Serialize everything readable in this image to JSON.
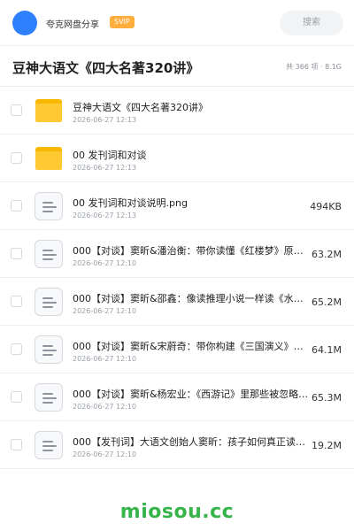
{
  "header": {
    "user_name": "夸克网盘分享",
    "badge": "SVIP",
    "search_placeholder": "搜索"
  },
  "folder": {
    "title": "豆神大语文《四大名著320讲》",
    "meta": "共 366 项 · 8.1G"
  },
  "files": [
    {
      "type": "folder",
      "name": "豆神大语文《四大名著320讲》",
      "date": "2026-06-27 12:13",
      "size": ""
    },
    {
      "type": "folder",
      "name": "00 发刊词和对谈",
      "date": "2026-06-27 12:13",
      "size": ""
    },
    {
      "type": "file",
      "name": "00 发刊词和对谈说明.png",
      "date": "2026-06-27 12:13",
      "size": "494KB"
    },
    {
      "type": "file",
      "name": "000【对谈】窦昕&潘治衡：带你读懂《红楼梦》原著…",
      "date": "2026-06-27 12:10",
      "size": "63.2M"
    },
    {
      "type": "file",
      "name": "000【对谈】窦昕&邵鑫：像读推理小说一样读《水浒…",
      "date": "2026-06-27 12:10",
      "size": "65.2M"
    },
    {
      "type": "file",
      "name": "000【对谈】窦昕&宋蔚奇：带你构建《三国演义》的…",
      "date": "2026-06-27 12:10",
      "size": "64.1M"
    },
    {
      "type": "file",
      "name": "000【对谈】窦昕&杨宏业：《西游记》里那些被忽略…",
      "date": "2026-06-27 12:10",
      "size": "65.3M"
    },
    {
      "type": "file",
      "name": "000【发刊词】大语文创始人窦昕：孩子如何真正读懂…",
      "date": "2026-06-27 12:10",
      "size": "19.2M"
    }
  ],
  "footer": {
    "watermark": "miosou.cc"
  },
  "colors": {
    "accent": "#2f80ff",
    "badge": "#ffad3d",
    "folder": "#ffc933",
    "watermark": "#37b44a"
  }
}
